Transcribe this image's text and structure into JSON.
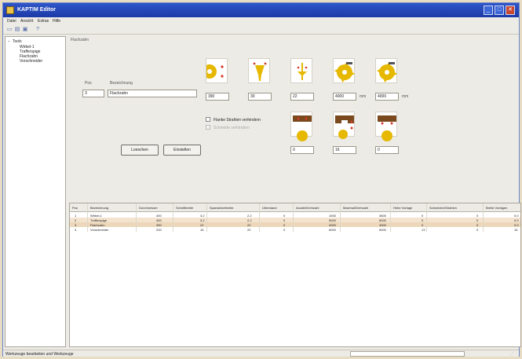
{
  "window": {
    "title": "KAPTIM Editor",
    "min": "_",
    "max": "□",
    "close": "✕"
  },
  "menu": [
    "Datei",
    "Ansicht",
    "Extras",
    "Hilfe"
  ],
  "toolbar": [
    "new-icon",
    "open-icon",
    "save-icon",
    "help-icon"
  ],
  "tree": {
    "root": "Tools",
    "toggle": "−",
    "items": [
      "Wirbel-1",
      "Trafferspige",
      "Flachzahn",
      "Vorschneider"
    ]
  },
  "panel": {
    "title": "Flachzahn"
  },
  "form": {
    "pos_label": "Pos",
    "pos_value": "3",
    "name_label": "Bezeichnung",
    "name_value": "Flachzahn",
    "param_values": [
      "390",
      "30",
      "22",
      "4000",
      "4000"
    ],
    "unit_suffix": "mm",
    "bottom_values": [
      "0",
      "16",
      "0"
    ],
    "checkbox1": "Flanke Strahlen verhindern",
    "checkbox2": "Schneide verhindern",
    "btn_delete": "Loeschen",
    "btn_insert": "Einstellen"
  },
  "table": {
    "columns": [
      "Pos",
      "Bezeichnung",
      "Durchmesser",
      "Schnittbreite",
      "Spanwinkelbreite",
      "Überstand",
      "Anzahl/Drehzahl",
      "Maximal/Drehzahl",
      "Höhe Vorlage",
      "Schneiden/Strahlen",
      "Breite Vorlagen"
    ],
    "rows": [
      [
        "1",
        "Wirbel-1",
        "400",
        "3.2",
        "2.2",
        "0",
        "1000",
        "3600",
        "0",
        "0",
        "0.0"
      ],
      [
        "2",
        "Trafferspige",
        "400",
        "3.2",
        "2.2",
        "0",
        "5000",
        "6000",
        "0",
        "0",
        "0.0"
      ],
      [
        "3",
        "Flachzahn",
        "390",
        "22",
        "22",
        "0",
        "4000",
        "4000",
        "0",
        "0",
        "0.0"
      ],
      [
        "4",
        "Vorschneider",
        "200",
        "16",
        "20",
        "0",
        "6000",
        "6000",
        "13",
        "0",
        "16"
      ]
    ]
  },
  "status": {
    "message": "Werkzeuge bearbeiten und Werkzeuge",
    "grip": "⋰"
  },
  "colors": {
    "accent": "#1c3aa8",
    "tool": "#e6b800",
    "wood": "#7a4a1e",
    "marker": "#d23a2a",
    "row_alt": "#f3e3cf"
  }
}
